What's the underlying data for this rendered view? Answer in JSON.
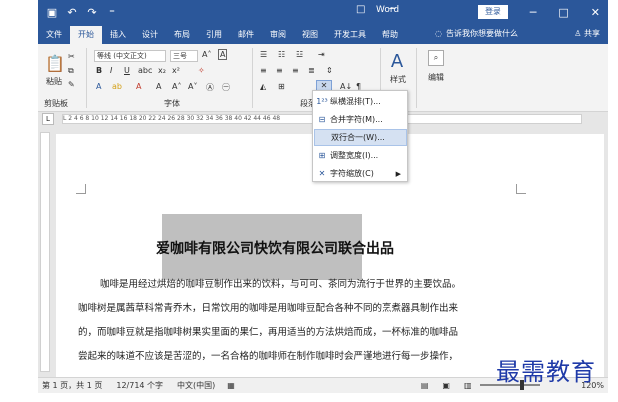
{
  "title_bar": {
    "doc_title": "Word",
    "login": "登录",
    "qat_icons": [
      "save-icon",
      "undo-icon",
      "redo-icon",
      "customize-icon"
    ]
  },
  "tabs": [
    "文件",
    "开始",
    "插入",
    "设计",
    "布局",
    "引用",
    "邮件",
    "审阅",
    "视图",
    "开发工具",
    "帮助"
  ],
  "active_tab": "开始",
  "tell_me": "告诉我你想要做什么",
  "share": "共享",
  "ribbon": {
    "clipboard": {
      "paste": "粘贴",
      "label": "剪贴板"
    },
    "font": {
      "font_name": "等线 (中文正文)",
      "font_size": "三号",
      "label": "字体",
      "bold": "B",
      "italic": "I",
      "underline": "U"
    },
    "paragraph": {
      "label": "段落"
    },
    "styles": {
      "label": "样式"
    },
    "editing": {
      "label": "编辑"
    }
  },
  "ruler_text": "L  2  4  6  8  10  12  14  16  18  20  22  24  26  28  30  32  34  36  38  40  42  44  46  48",
  "menu": [
    {
      "label": "纵横混排(T)...",
      "icon": "vertical-horizontal-icon"
    },
    {
      "label": "合并字符(M)...",
      "icon": "combine-chars-icon"
    },
    {
      "label": "双行合一(W)...",
      "icon": "two-lines-in-one-icon",
      "highlighted": true
    },
    {
      "label": "调整宽度(I)...",
      "icon": "adjust-width-icon"
    },
    {
      "label": "字符缩放(C)",
      "icon": "char-scale-icon",
      "submenu": true
    }
  ],
  "document": {
    "heading_highlight": "爱咖啡有限公司快饮有限公司",
    "heading_rest": "联合出品",
    "paragraphs": [
      "咖啡是用经过烘焙的咖啡豆制作出来的饮料，与可可、茶同为流行于世界的主要饮品。",
      "咖啡树是属茜草科常青乔木，日常饮用的咖啡是用咖啡豆配合各种不同的烹煮器具制作出来",
      "的，而咖啡豆就是指咖啡树果实里面的果仁，再用适当的方法烘焙而成，一杯标准的咖啡品",
      "尝起来的味道不应该是苦涩的，一名合格的咖啡师在制作咖啡时会严谨地进行每一步操作，"
    ]
  },
  "status_bar": {
    "page": "第 1 页，共 1 页",
    "words": "12/714 个字",
    "language": "中文(中国)",
    "zoom": "120%"
  },
  "watermark": "最需教育"
}
